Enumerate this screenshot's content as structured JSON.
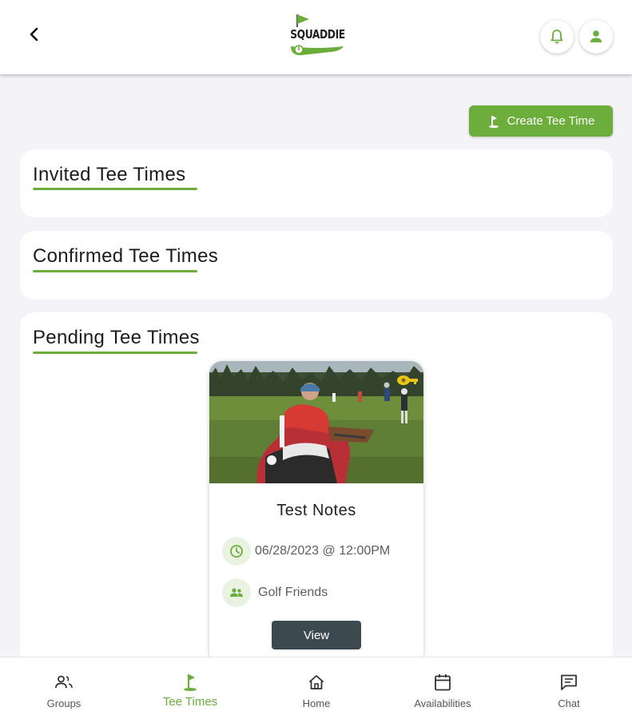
{
  "header": {
    "logo_text": "SQUADDIE",
    "colors": {
      "brand": "#6dad3c",
      "dark": "#3c4a4f"
    },
    "icons": {
      "back": "chevron-left-icon",
      "notifications": "bell-icon",
      "profile": "user-icon"
    }
  },
  "actions": {
    "create_label": "Create Tee Time"
  },
  "sections": {
    "invited": {
      "title": "Invited Tee Times"
    },
    "confirmed": {
      "title": "Confirmed Tee Times"
    },
    "pending": {
      "title": "Pending Tee Times"
    }
  },
  "card": {
    "title": "Test Notes",
    "datetime": "06/28/2023 @ 12:00PM",
    "group": "Golf Friends",
    "view_label": "View"
  },
  "nav": {
    "active": "Tee Times",
    "items": [
      {
        "label": "Groups",
        "icon": "groups-icon"
      },
      {
        "label": "Tee Times",
        "icon": "golf-flag-icon"
      },
      {
        "label": "Home",
        "icon": "home-icon"
      },
      {
        "label": "Availabilities",
        "icon": "calendar-icon"
      },
      {
        "label": "Chat",
        "icon": "chat-icon"
      }
    ]
  }
}
